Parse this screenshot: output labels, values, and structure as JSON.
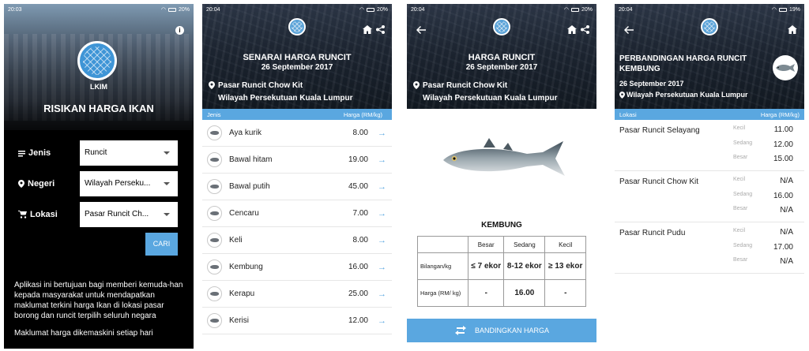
{
  "screen1": {
    "status_time": "20:03",
    "status_battery": "20%",
    "logo_text": "LKIM",
    "app_title": "RISIKAN HARGA IKAN",
    "jenis_label": "Jenis",
    "jenis_value": "Runcit",
    "negeri_label": "Negeri",
    "negeri_value": "Wilayah Perseku...",
    "lokasi_label": "Lokasi",
    "lokasi_value": "Pasar Runcit Ch...",
    "cari_label": "CARI",
    "description": "Aplikasi ini bertujuan bagi memberi kemuda-han kepada masyarakat untuk mendapatkan maklumat terkini harga Ikan di lokasi pasar borong dan runcit terpilih seluruh negara",
    "description_more": "Maklumat harga dikemaskini setiap hari"
  },
  "screen2": {
    "status_time": "20:04",
    "status_battery": "20%",
    "title": "SENARAI HARGA RUNCIT",
    "date": "26 September 2017",
    "location_line1": "Pasar Runcit Chow Kit",
    "location_line2": "Wilayah Persekutuan Kuala Lumpur",
    "col_jenis": "Jenis",
    "col_harga": "Harga (RM/kg)",
    "fish": [
      {
        "name": "Aya kurik",
        "price": "8.00"
      },
      {
        "name": "Bawal hitam",
        "price": "19.00"
      },
      {
        "name": "Bawal putih",
        "price": "45.00"
      },
      {
        "name": "Cencaru",
        "price": "7.00"
      },
      {
        "name": "Keli",
        "price": "8.00"
      },
      {
        "name": "Kembung",
        "price": "16.00"
      },
      {
        "name": "Kerapu",
        "price": "25.00"
      },
      {
        "name": "Kerisi",
        "price": "12.00"
      }
    ]
  },
  "screen3": {
    "status_time": "20:04",
    "status_battery": "20%",
    "title": "HARGA RUNCIT",
    "date": "26 September 2017",
    "location_line1": "Pasar Runcit Chow Kit",
    "location_line2": "Wilayah Persekutuan Kuala Lumpur",
    "fish_name": "KEMBUNG",
    "table": {
      "headers": [
        "",
        "Besar",
        "Sedang",
        "Kecil"
      ],
      "row1": [
        "Bilangan/kg",
        "≤ 7 ekor",
        "8-12 ekor",
        "≥ 13 ekor"
      ],
      "row2": [
        "Harga (RM/ kg)",
        "-",
        "16.00",
        "-"
      ]
    },
    "compare_label": "BANDINGKAN HARGA"
  },
  "screen4": {
    "status_time": "20:04",
    "status_battery": "19%",
    "title_line1": "PERBANDINGAN HARGA RUNCIT",
    "title_line2": "KEMBUNG",
    "date": "26 September 2017",
    "location": "Wilayah Persekutuan Kuala Lumpur",
    "col_lokasi": "Lokasi",
    "col_harga": "Harga (RM/kg)",
    "markets": [
      {
        "name": "Pasar Runcit Selayang",
        "grades": [
          {
            "label": "Kecil",
            "value": "11.00"
          },
          {
            "label": "Sedang",
            "value": "12.00"
          },
          {
            "label": "Besar",
            "value": "15.00"
          }
        ]
      },
      {
        "name": "Pasar Runcit Chow Kit",
        "grades": [
          {
            "label": "Kecil",
            "value": "N/A"
          },
          {
            "label": "Sedang",
            "value": "16.00"
          },
          {
            "label": "Besar",
            "value": "N/A"
          }
        ]
      },
      {
        "name": "Pasar Runcit Pudu",
        "grades": [
          {
            "label": "Kecil",
            "value": "N/A"
          },
          {
            "label": "Sedang",
            "value": "17.00"
          },
          {
            "label": "Besar",
            "value": "N/A"
          }
        ]
      }
    ]
  }
}
